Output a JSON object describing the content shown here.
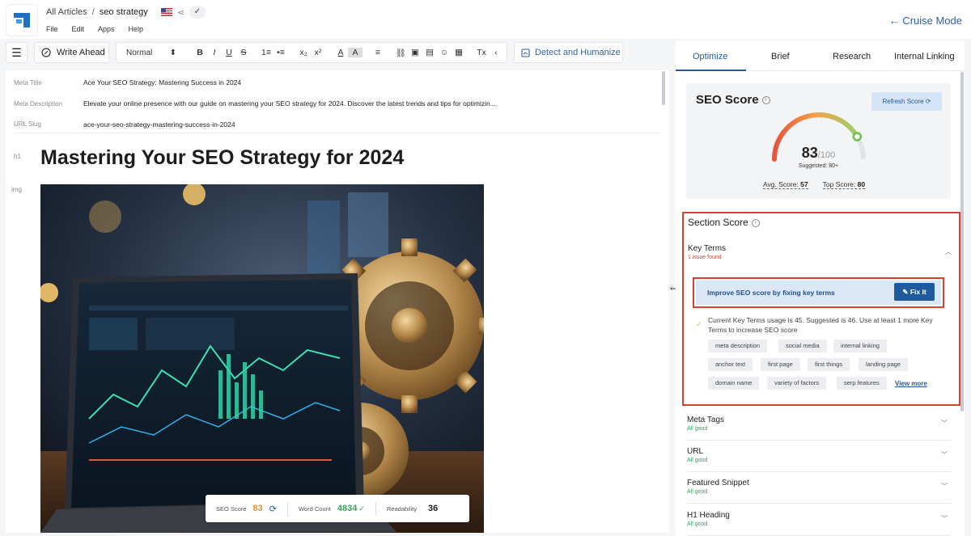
{
  "header": {
    "breadcrumb_root": "All Articles",
    "breadcrumb_sep": "/",
    "breadcrumb_current": "seo strategy",
    "menu": [
      "File",
      "Edit",
      "Apps",
      "Help"
    ],
    "cruise_mode": "← Cruise Mode",
    "check": "✓",
    "share": "⋖"
  },
  "toolbar": {
    "outline_icon": "☰",
    "write_ahead": "Write Ahead",
    "block_style": "Normal",
    "block_style_arrow": "⬍",
    "format_icons": [
      "B",
      "I",
      "U",
      "S",
      "1≡",
      "•≡",
      "x₂",
      "x²",
      "A",
      "A",
      "≡",
      "⛓",
      "▣",
      "▤",
      "☺",
      "▦",
      "Tx",
      "‹"
    ],
    "detect": "Detect and Humanize"
  },
  "editor": {
    "meta_title_label": "Meta Title",
    "meta_title": "Ace Your SEO Strategy: Mastering Success in 2024",
    "meta_desc_label": "Meta Description",
    "meta_desc": "Elevate your online presence with our guide on mastering your SEO strategy for 2024. Discover the latest trends and tips for optimizin...",
    "slug_label": "URL Slug",
    "slug": "ace-your-seo-strategy-mastering-success-in-2024",
    "h1_tag": "h1",
    "img_tag": "img",
    "heading": "Mastering Your SEO Strategy for 2024",
    "stats": {
      "seo_label": "SEO Score",
      "seo_value": "83",
      "wc_label": "Word Count",
      "wc_value": "4834",
      "read_label": "Readability",
      "read_value": "36"
    }
  },
  "panel": {
    "tabs": [
      "Optimize",
      "Brief",
      "Research",
      "Internal Linking"
    ],
    "active_tab": "Optimize",
    "seo_title": "SEO Score",
    "refresh": "Refresh Score ⟳",
    "score": "83",
    "score_max": "/100",
    "suggested": "Suggested: 80+",
    "avg_label": "Avg. Score:",
    "avg_value": "57",
    "top_label": "Top Score:",
    "top_value": "80",
    "section_title": "Section Score",
    "key_terms": "Key Terms",
    "key_terms_issue": "1 issue found",
    "fix_text": "Improve SEO score by fixing key terms",
    "fix_btn": "Fix It",
    "usage": "Current Key Terms usage is 45. Suggested is 46. Use at least 1 more Key Terms to increase SEO score",
    "chips": [
      "meta description",
      "social media",
      "internal linking",
      "anchor text",
      "first page",
      "first things",
      "landing page",
      "domain name",
      "variety of factors",
      "serp features"
    ],
    "view_more": "View more",
    "accordions": [
      {
        "title": "Meta Tags",
        "status": "All good"
      },
      {
        "title": "URL",
        "status": "All good"
      },
      {
        "title": "Featured Snippet",
        "status": "All good"
      },
      {
        "title": "H1 Heading",
        "status": "All good"
      }
    ]
  },
  "colors": {
    "accent": "#1f5a9e",
    "highlight_border": "#d3432f",
    "good": "#2aa55a",
    "score_orange": "#e8902a"
  },
  "gauge": {
    "value": 83,
    "max": 100
  }
}
